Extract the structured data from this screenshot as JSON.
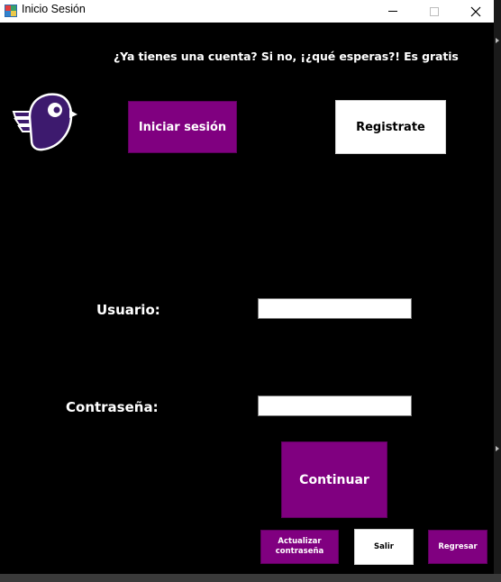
{
  "window": {
    "title": "Inicio Sesión",
    "controls": {
      "minimize": "",
      "maximize": "",
      "close": "✕"
    }
  },
  "header": {
    "prompt": "¿Ya tienes una cuenta? Si no, ¡¿qué esperas?! Es gratis"
  },
  "tabs": {
    "login_label": "Iniciar sesión",
    "register_label": "Registrate"
  },
  "form": {
    "user_label": "Usuario:",
    "user_value": "",
    "password_label": "Contraseña:",
    "password_value": ""
  },
  "actions": {
    "continue_label": "Continuar",
    "update_password_label": "Actualizar contraseña",
    "exit_label": "Salir",
    "back_label": "Regresar"
  },
  "colors": {
    "accent": "#800080",
    "logo": "#3d1a6e",
    "background": "#000000"
  },
  "icons": {
    "app": "app-window-icon",
    "logo": "bird-logo-icon"
  }
}
